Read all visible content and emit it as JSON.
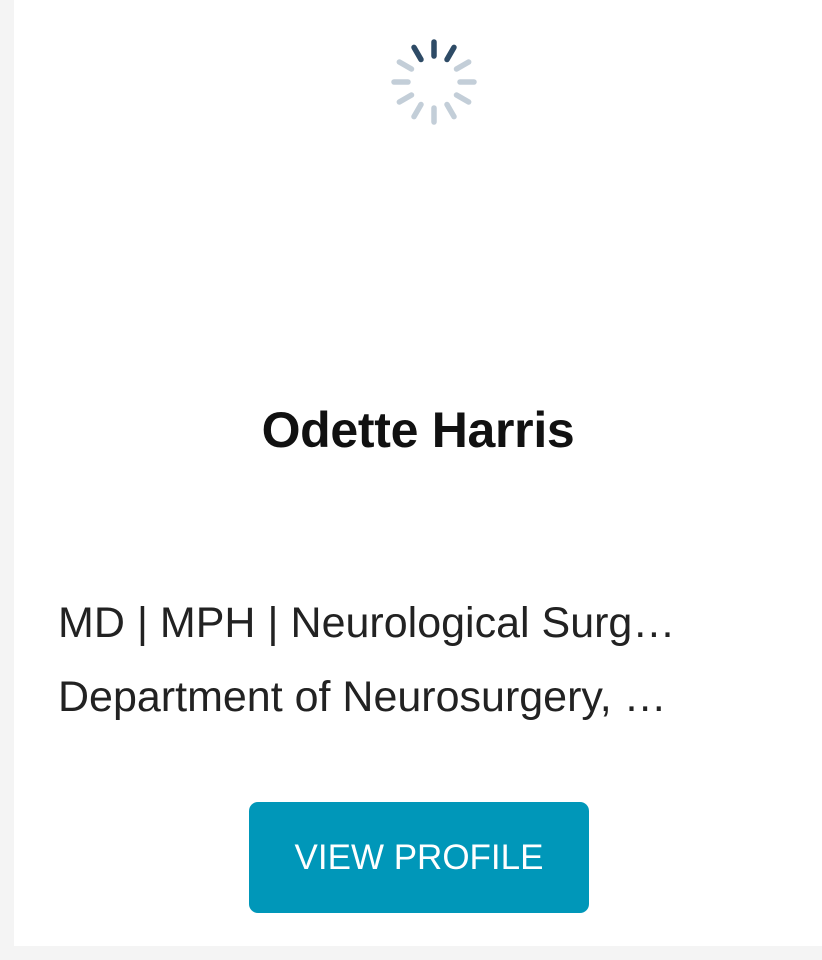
{
  "profile": {
    "name": "Odette Harris",
    "credentials_line": "MD | MPH | Neurological Surg…",
    "department_line": "Department of Neurosurgery, …",
    "button_label": "VIEW PROFILE"
  },
  "colors": {
    "button_bg": "#0097b9",
    "button_text": "#ffffff",
    "spinner_dark": "#2e4b66",
    "spinner_light": "#b9c6d2"
  },
  "icons": {
    "loader": "loading-spinner-icon"
  }
}
